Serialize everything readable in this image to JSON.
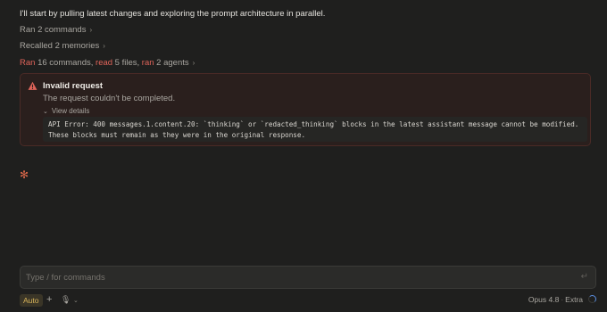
{
  "intro_text": "I'll start by pulling latest changes and exploring the prompt architecture in parallel.",
  "activity": {
    "ran_commands": "Ran 2 commands",
    "recalled_memories": "Recalled 2 memories",
    "summary": {
      "ran_label": "Ran",
      "commands_text": " 16 commands, ",
      "read_label": "read",
      "files_text": " 5 files, ",
      "ran2_label": "ran",
      "agents_text": " 2 agents"
    },
    "chevron": "›"
  },
  "error": {
    "title": "Invalid request",
    "subtitle": "The request couldn't be completed.",
    "toggle_label": "View details",
    "details": "API Error: 400 messages.1.content.20: `thinking` or `redacted_thinking` blocks in the latest assistant message cannot be modified. These blocks must remain as they were in the original response."
  },
  "composer": {
    "placeholder": "Type / for commands",
    "mode_badge": "Auto",
    "plus": "+",
    "mic_icon": "mic-icon",
    "model_name": "Opus 4.8",
    "model_sep": "·",
    "model_variant": "Extra"
  },
  "colors": {
    "background": "#1f1f1e",
    "accent_red": "#e0645a",
    "error_bg": "#2a1f1d",
    "badge_gold": "#d9b55a"
  }
}
